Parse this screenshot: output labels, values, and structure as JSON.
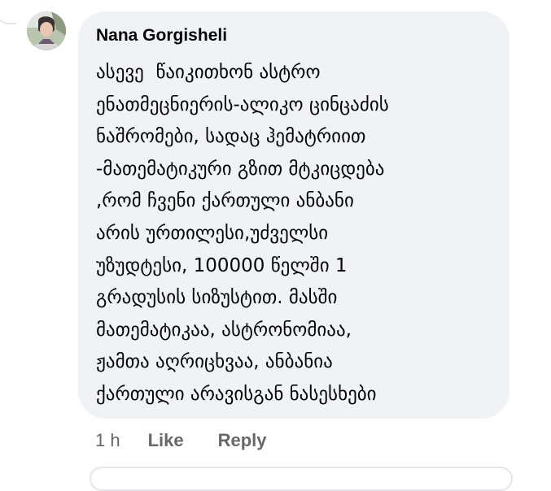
{
  "comment": {
    "author": "Nana Gorgisheli",
    "lines": [
      "ასევე  წაიკითხონ ასტრო",
      "ენათმეცნიერის-ალიკო ცინცაძის",
      "ნაშრომები, სადაც ჰემატრიით",
      "-მათემატიკური გზით მტკიცდება",
      ",რომ ჩვენი ქართული ანბანი",
      "არის ურთილესი,უძველსი",
      "უზუდტესი, 100000 წელში 1",
      "გრადუსის სიზუსტით. მასში",
      "მათემატიკაა, ასტრონომიაა,",
      "ჟამთა აღრიცხვაა, ანბანია",
      "ქართული არავისგან ნასესხები"
    ]
  },
  "actions": {
    "timestamp": "1 h",
    "like_label": "Like",
    "reply_label": "Reply"
  },
  "colors": {
    "bubble_bg": "#f0f2f5",
    "text": "#050505",
    "secondary": "#65676b"
  }
}
